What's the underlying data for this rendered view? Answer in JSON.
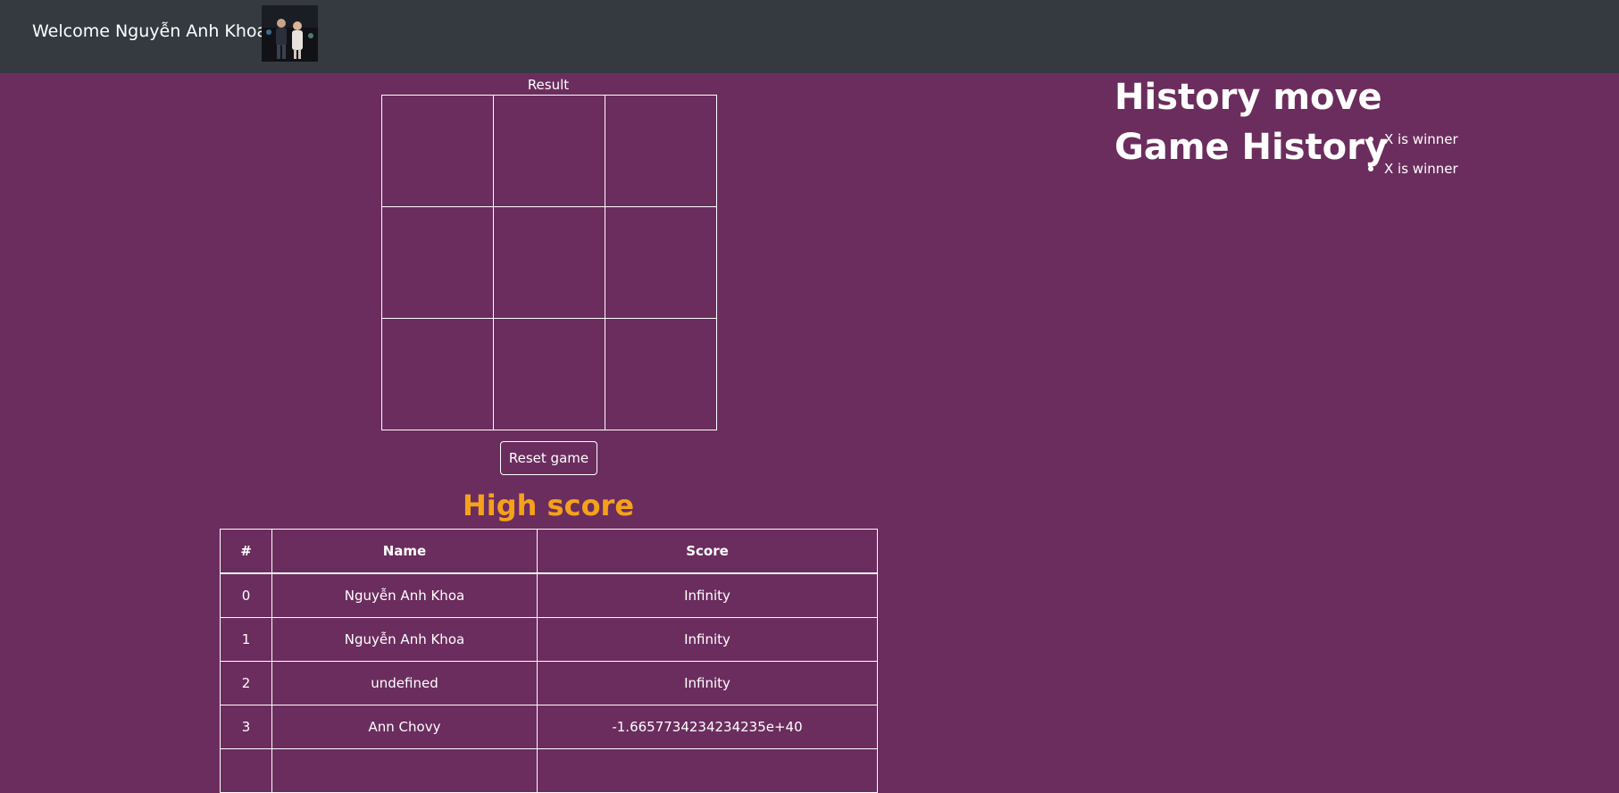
{
  "theme": {
    "background": "#6b2d5e",
    "navbar": "#343a40",
    "accent": "#f5a21b"
  },
  "navbar": {
    "welcome_text": "Welcome Nguyễn Anh Khoa",
    "avatar_icon": "user-avatar-photo"
  },
  "game": {
    "result_label": "Result",
    "board": [
      "",
      "",
      "",
      "",
      "",
      "",
      "",
      "",
      ""
    ],
    "reset_label": "Reset game"
  },
  "high_score": {
    "title": "High score",
    "headers": [
      "#",
      "Name",
      "Score"
    ],
    "rows": [
      [
        "0",
        "Nguyễn Anh Khoa",
        "Infinity"
      ],
      [
        "1",
        "Nguyễn Anh Khoa",
        "Infinity"
      ],
      [
        "2",
        "undefined",
        "Infinity"
      ],
      [
        "3",
        "Ann Chovy",
        "-1.6657734234234235e+40"
      ]
    ]
  },
  "history": {
    "move_title": "History move",
    "game_title": "Game History",
    "games": [
      "X is winner",
      "X is winner"
    ]
  }
}
